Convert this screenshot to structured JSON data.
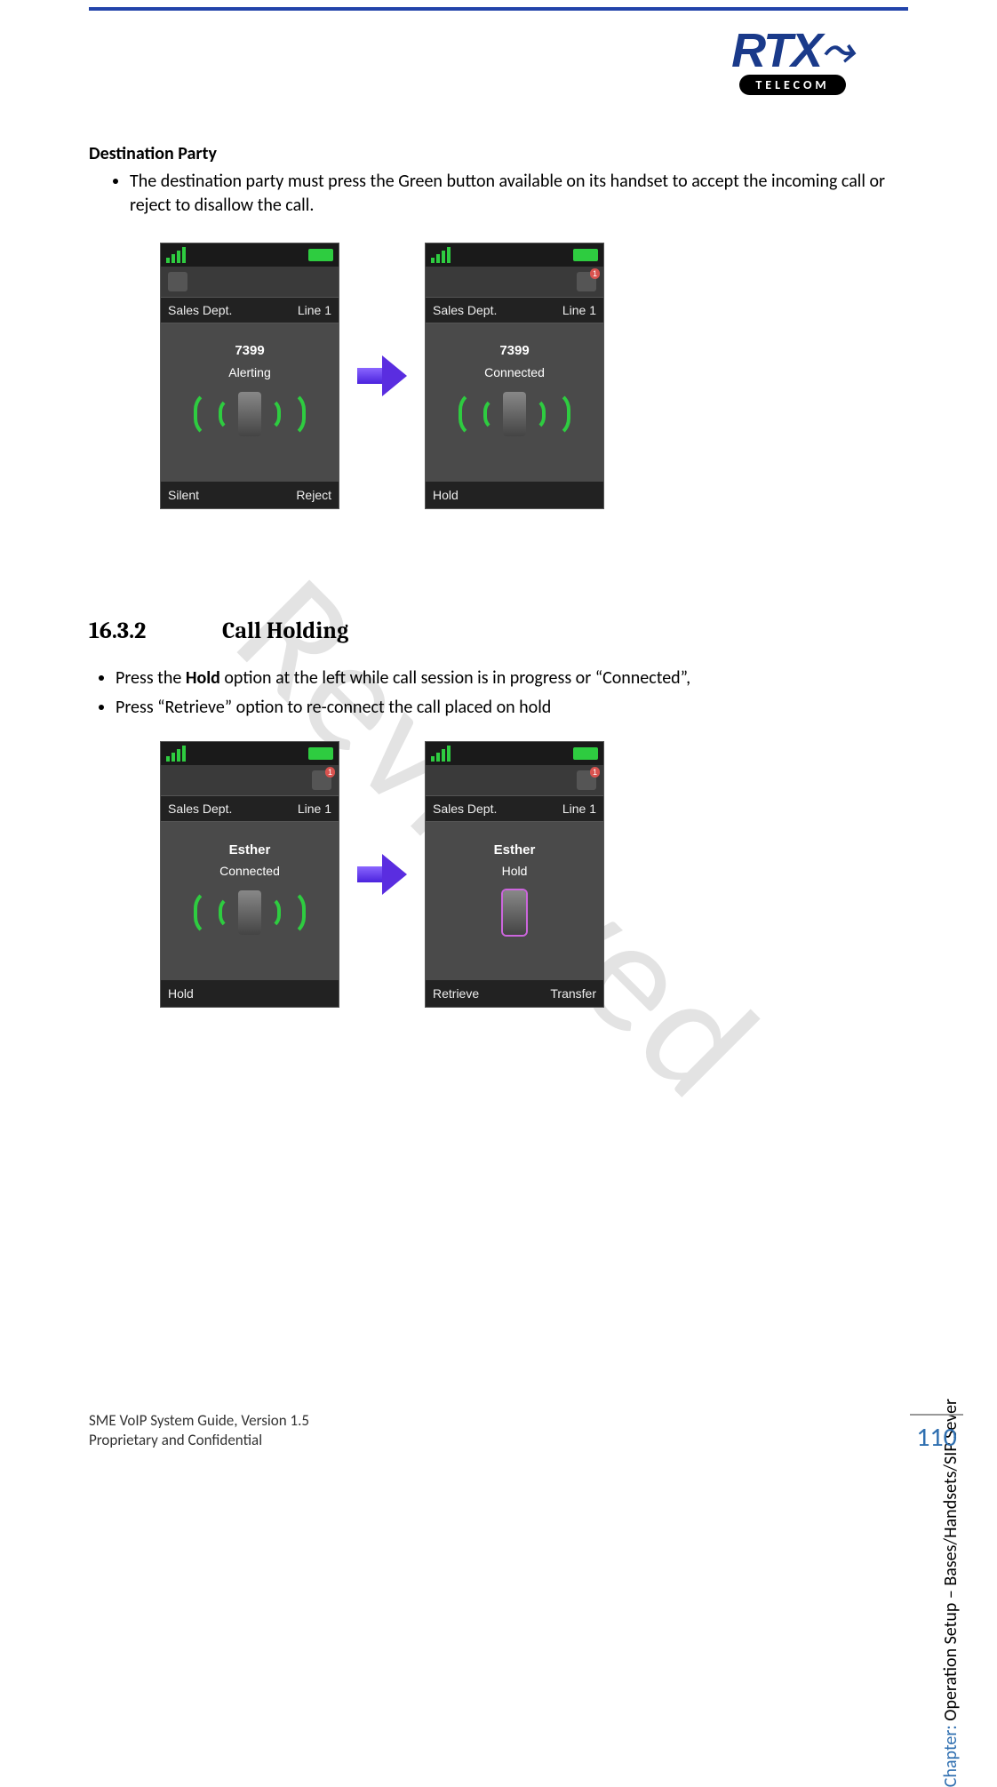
{
  "logo": {
    "brand": "RTX",
    "sub": "TELECOM"
  },
  "watermark": "Reviewed",
  "sec1": {
    "heading": "Destination Party",
    "bullet1": "The destination party must press the Green button available on its handset to accept the incoming call or reject to disallow the call."
  },
  "screens1": {
    "a": {
      "dept": "Sales Dept.",
      "line": "Line 1",
      "name": "7399",
      "state": "Alerting",
      "softL": "Silent",
      "softR": "Reject"
    },
    "b": {
      "dept": "Sales Dept.",
      "line": "Line 1",
      "name": "7399",
      "state": "Connected",
      "softL": "Hold",
      "softR": ""
    }
  },
  "sec2": {
    "num": "16.3.2",
    "title": "Call Holding",
    "bullet1_pre": "Press the ",
    "bullet1_bold": "Hold",
    "bullet1_post": " option at the left while call session is in progress or “Connected”,",
    "bullet2": "Press “Retrieve” option to re-connect the call placed on hold"
  },
  "screens2": {
    "a": {
      "dept": "Sales Dept.",
      "line": "Line 1",
      "name": "Esther",
      "state": "Connected",
      "softL": "Hold",
      "softR": ""
    },
    "b": {
      "dept": "Sales Dept.",
      "line": "Line 1",
      "name": "Esther",
      "state": "Hold",
      "softL": "Retrieve",
      "softR": "Transfer"
    }
  },
  "side": {
    "prefix": "Chapter: ",
    "text": "Operation Setup – Bases/Handsets/SIP Sever"
  },
  "footer": {
    "line1": "SME VoIP System Guide, Version 1.5",
    "line2": "Proprietary and Confidential"
  },
  "pagenum": "110"
}
